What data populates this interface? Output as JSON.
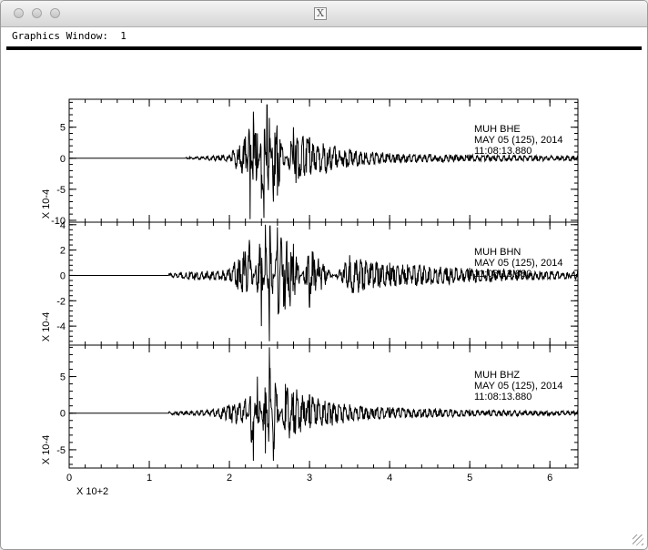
{
  "window": {
    "title_icon": "x11-logo-icon",
    "graphics_label": "Graphics Window:  1"
  },
  "chart_data": {
    "type": "line",
    "x_axis": {
      "range": [
        0,
        6.35
      ],
      "ticks": [
        0,
        1,
        2,
        3,
        4,
        5,
        6
      ],
      "tick_labels": [
        "0",
        "1",
        "2",
        "3",
        "4",
        "5",
        "6"
      ],
      "multiplier_label": "X 10+2"
    },
    "panels": [
      {
        "station": "MUH   BHE",
        "date": "MAY 05 (125), 2014",
        "time": "11:08:13.880",
        "ylabel": "X 10-4",
        "ylim": [
          -10.3,
          9.5
        ],
        "yticks": [
          5,
          0,
          -5,
          -10
        ],
        "ytick_labels": [
          "5",
          "0",
          "-5",
          "-10"
        ],
        "onset": 1.45,
        "peak_time": 2.45,
        "envelope_peak": 8.5,
        "signal": {
          "x": [
            0,
            1.5,
            2.0,
            2.2,
            2.26,
            2.3,
            2.35,
            2.4,
            2.43,
            2.47,
            2.5,
            2.55,
            2.6,
            2.8,
            3.0,
            3.5,
            4.0,
            5.0,
            6.3
          ],
          "y": [
            0,
            0.2,
            0.6,
            3.5,
            -9.8,
            7.5,
            4.0,
            -6.5,
            -9.6,
            8.6,
            6.5,
            -7.0,
            -6.0,
            5.0,
            3.3,
            1.5,
            0.8,
            0.6,
            0.4
          ]
        }
      },
      {
        "station": "MUH   BHN",
        "date": "MAY 05 (125), 2014",
        "time": "11:08:13.880",
        "ylabel": "X 10-4",
        "ylim": [
          -5.5,
          4.2
        ],
        "yticks": [
          4,
          2,
          0,
          -2,
          -4
        ],
        "ytick_labels": [
          "4",
          "2",
          "0",
          "-2",
          "-4"
        ],
        "onset": 1.25,
        "peak_time": 2.48,
        "envelope_peak": 4.0,
        "signal": {
          "x": [
            0,
            1.25,
            1.5,
            2.0,
            2.25,
            2.4,
            2.45,
            2.5,
            2.6,
            2.8,
            3.0,
            3.5,
            4.0,
            5.0,
            6.3
          ],
          "y": [
            0,
            0.15,
            0.3,
            0.5,
            2.8,
            -4.0,
            4.2,
            -5.2,
            3.8,
            2.5,
            -2.5,
            1.6,
            1.0,
            0.6,
            0.3
          ]
        }
      },
      {
        "station": "MUH   BHZ",
        "date": "MAY 05 (125), 2014",
        "time": "11:08:13.880",
        "ylabel": "X 10-4",
        "ylim": [
          -7.5,
          9.3
        ],
        "yticks": [
          5,
          0,
          -5
        ],
        "ytick_labels": [
          "5",
          "0",
          "-5"
        ],
        "onset": 1.25,
        "peak_time": 2.5,
        "envelope_peak": 7.0,
        "signal": {
          "x": [
            0,
            1.25,
            1.8,
            2.2,
            2.3,
            2.35,
            2.45,
            2.5,
            2.55,
            2.7,
            3.0,
            3.5,
            4.0,
            5.0,
            6.3
          ],
          "y": [
            0,
            0.2,
            0.5,
            2.0,
            -6.5,
            5.0,
            -5.5,
            9.0,
            -6.5,
            4.0,
            2.5,
            1.2,
            0.8,
            0.5,
            0.3
          ]
        }
      }
    ]
  }
}
